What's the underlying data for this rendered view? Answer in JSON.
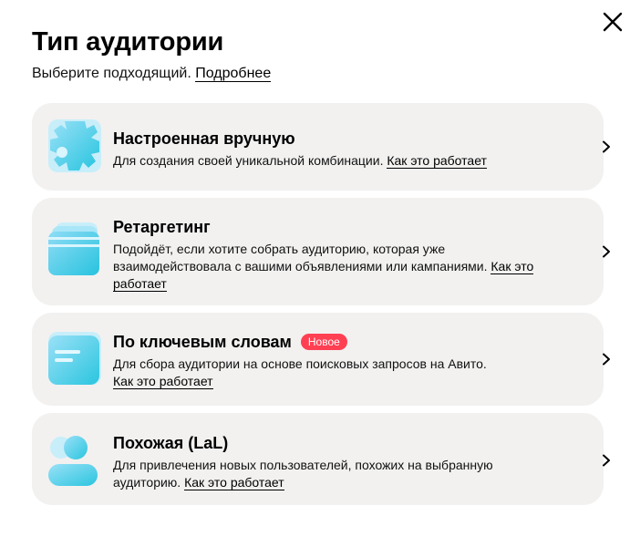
{
  "dialog": {
    "title": "Тип аудитории",
    "subtitle": "Выберите подходящий.",
    "details_link": "Подробнее",
    "close_icon": "close-icon"
  },
  "accent_colors": {
    "badge": "#ff4053",
    "icon_gradient_start": "#7fd6f5",
    "icon_gradient_end": "#2bc6e0",
    "card_background": "#f2f1f0"
  },
  "cards": [
    {
      "icon": "gear-icon",
      "title": "Настроенная вручную",
      "description": "Для создания своей уникальной комбинации.",
      "link": "Как это работает"
    },
    {
      "icon": "cards-stack-icon",
      "title": "Ретаргетинг",
      "description": "Подойдёт, если хотите собрать аудиторию, которая уже взаимодействовала с вашими объявлениями или кампаниями.",
      "link": "Как это работает"
    },
    {
      "icon": "document-icon",
      "title": "По ключевым словам",
      "badge": "Новое",
      "description": "Для сбора аудитории на основе поисковых запросов на Авито.",
      "link": "Как это работает"
    },
    {
      "icon": "users-icon",
      "title": "Похожая (LaL)",
      "description": "Для привлечения новых пользователей, похожих на выбранную аудиторию.",
      "link": "Как это работает"
    }
  ]
}
